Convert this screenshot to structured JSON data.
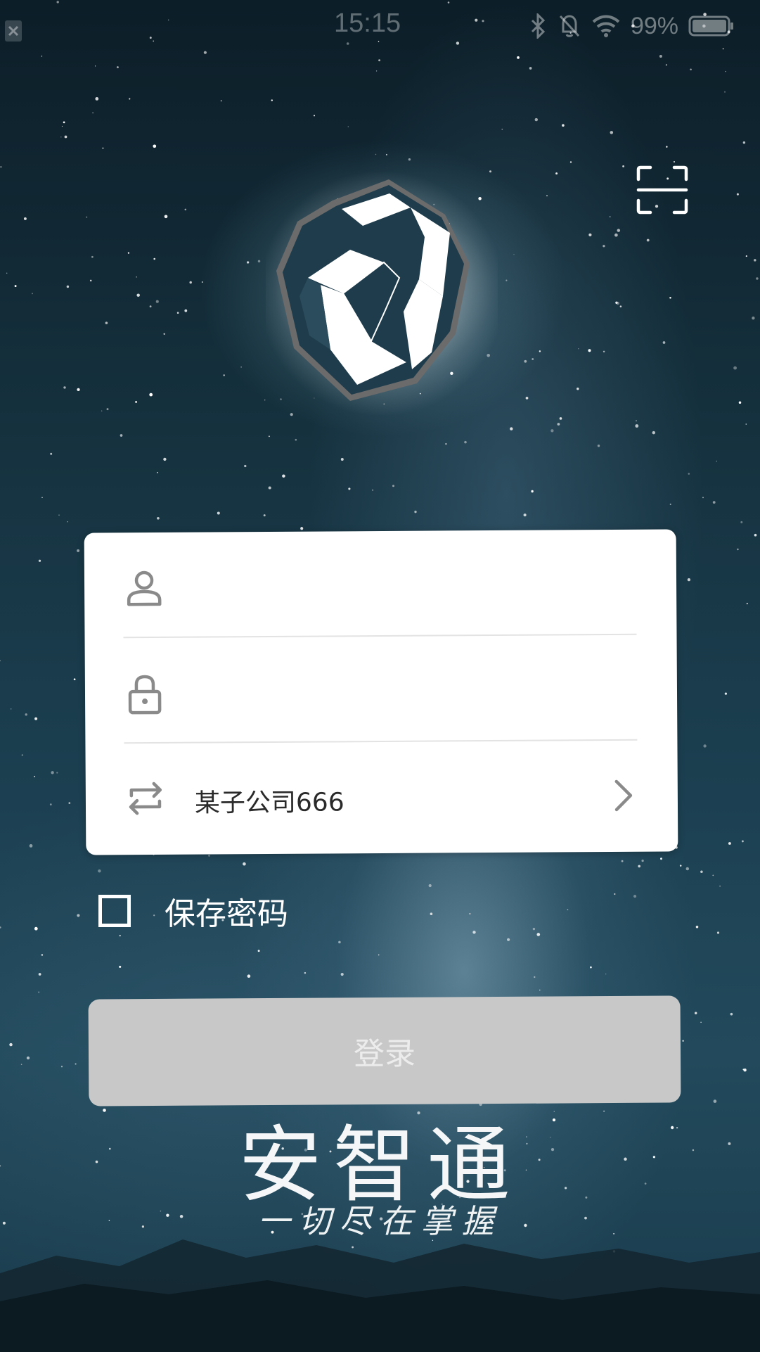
{
  "status_bar": {
    "time": "15:15",
    "battery": "99%",
    "icons": [
      "bluetooth-icon",
      "mute-icon",
      "wifi-icon",
      "battery-icon"
    ]
  },
  "scan": {
    "icon": "scan-icon"
  },
  "login_form": {
    "username": {
      "value": "",
      "placeholder": "",
      "icon": "user-icon"
    },
    "password": {
      "value": "",
      "placeholder": "",
      "icon": "lock-icon"
    },
    "company": {
      "value": "某子公司666",
      "icon": "switch-icon"
    }
  },
  "save_password": {
    "label": "保存密码",
    "checked": false
  },
  "login_button": {
    "label": "登录"
  },
  "brand": {
    "name": "安智通",
    "slogan": "一切尽在掌握"
  },
  "colors": {
    "button_bg": "#c8c8c8",
    "card_bg": "#ffffff",
    "icon_gray": "#8a8a8a"
  }
}
